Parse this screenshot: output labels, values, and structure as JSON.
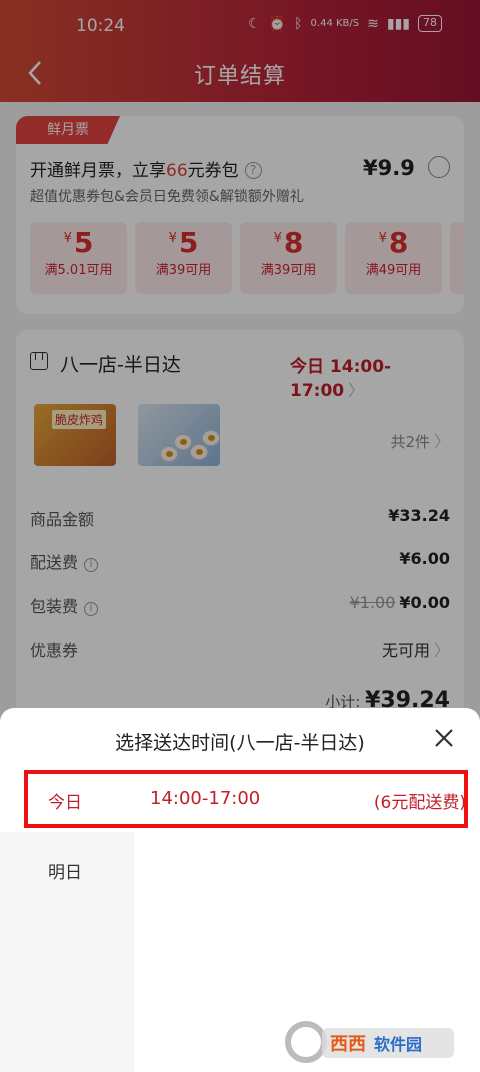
{
  "status_bar": {
    "time": "10:24",
    "net_speed": "0.44 KB/S",
    "battery": "78"
  },
  "header": {
    "title": "订单结算",
    "back_icon": "chevron-left-icon"
  },
  "promo": {
    "tag": "鲜月票",
    "title_prefix": "开通鲜月票，立享",
    "title_highlight": "66",
    "title_suffix": "元券包",
    "price": "¥9.9",
    "subtitle": "超值优惠券包&会员日免费领&解锁额外赠礼",
    "coupons": [
      {
        "currency": "¥",
        "amount": "5",
        "condition": "满5.01可用"
      },
      {
        "currency": "¥",
        "amount": "5",
        "condition": "满39可用"
      },
      {
        "currency": "¥",
        "amount": "8",
        "condition": "满39可用"
      },
      {
        "currency": "¥",
        "amount": "8",
        "condition": "满49可用"
      }
    ]
  },
  "order": {
    "store_name": "八一店-半日达",
    "delivery_time": "今日 14:00-17:00",
    "product_label": "脆皮炸鸡",
    "item_count": "共2件",
    "rows": {
      "goods_label": "商品金额",
      "goods_value": "¥33.24",
      "shipping_label": "配送费",
      "shipping_value": "¥6.00",
      "packing_label": "包装费",
      "packing_original": "¥1.00",
      "packing_value": "¥0.00",
      "coupon_label": "优惠券",
      "coupon_value": "无可用"
    },
    "subtotal_label": "小计:",
    "subtotal_value": "¥39.24"
  },
  "sheet": {
    "title": "选择送达时间(八一店-半日达)",
    "close_icon": "close-icon",
    "today": "今日",
    "tomorrow": "明日",
    "slot_time": "14:00-17:00",
    "slot_fee": "(6元配送费)"
  },
  "colors": {
    "accent_red": "#c1202a",
    "highlight_box": "#e11111",
    "header_gradient_start": "#d24a35",
    "header_gradient_end": "#9a1535"
  }
}
